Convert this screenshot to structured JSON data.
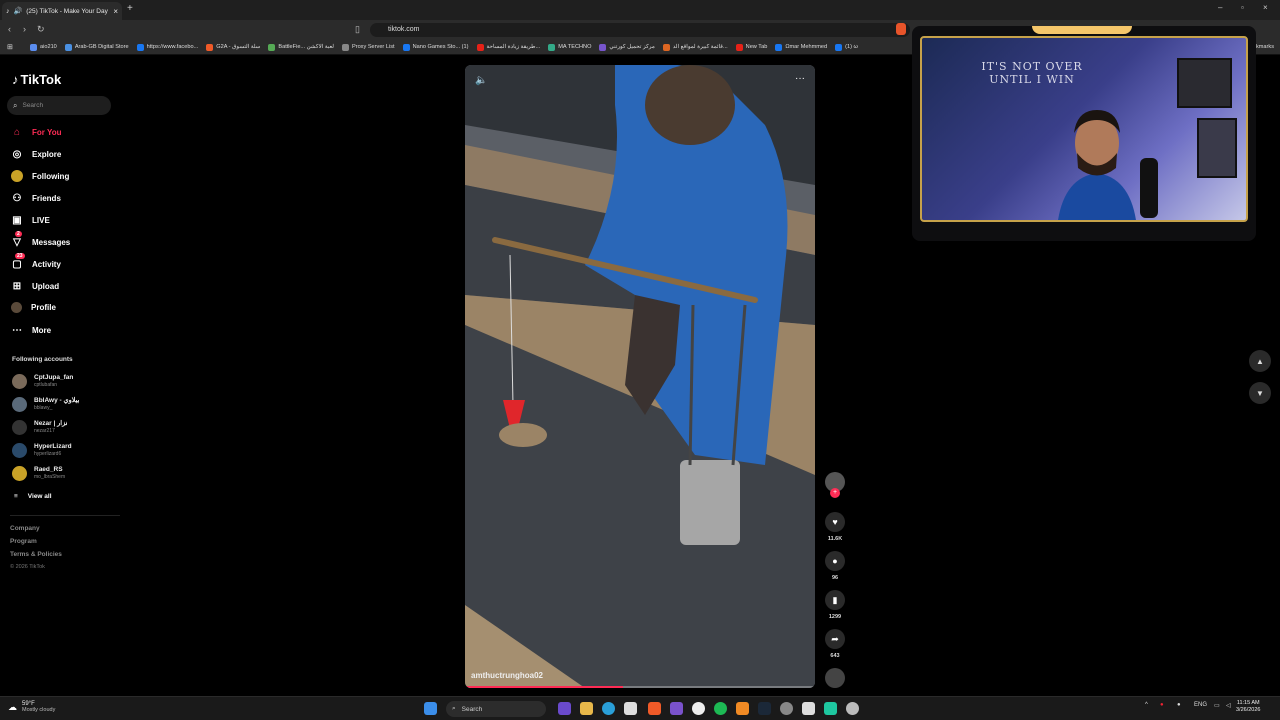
{
  "browser": {
    "tab_title": "(25) TikTok - Make Your Day",
    "url": "tiktok.com",
    "bookmarks": [
      {
        "label": "aio210",
        "color": "#5b8def"
      },
      {
        "label": "Arab-GB Digital Store",
        "color": "#4a90e2"
      },
      {
        "label": "https://www.facebo...",
        "color": "#1877f2"
      },
      {
        "label": "G2A - سلة التسوق",
        "color": "#f05a28"
      },
      {
        "label": "BattleFie... لعبة الاكشن",
        "color": "#55aa55"
      },
      {
        "label": "Proxy Server List",
        "color": "#888888"
      },
      {
        "label": "Nano Games Sto... (1)",
        "color": "#1877f2"
      },
      {
        "label": "طريقة زيادة المساحة...",
        "color": "#e62117"
      },
      {
        "label": "MA TECHNO",
        "color": "#33aa88"
      },
      {
        "label": "مركز تحميل كورتني",
        "color": "#7755cc"
      },
      {
        "label": "قائمة كبيرة لمواقع الد...",
        "color": "#dd6622"
      },
      {
        "label": "New Tab",
        "color": "#e62117"
      },
      {
        "label": "Ωmar Mehmmed",
        "color": "#1877f2"
      },
      {
        "label": "(1) ω",
        "color": "#1877f2"
      }
    ],
    "bookmarks_end": "Bookmarks"
  },
  "tiktok": {
    "logo": "TikTok",
    "search_placeholder": "Search",
    "nav": [
      {
        "label": "For You",
        "icon": "home-icon",
        "active": true
      },
      {
        "label": "Explore",
        "icon": "compass-icon"
      },
      {
        "label": "Following",
        "icon": "following-icon"
      },
      {
        "label": "Friends",
        "icon": "friends-icon"
      },
      {
        "label": "LIVE",
        "icon": "live-icon"
      },
      {
        "label": "Messages",
        "icon": "messages-icon",
        "badge": "2"
      },
      {
        "label": "Activity",
        "icon": "activity-icon",
        "badge": "23"
      },
      {
        "label": "Upload",
        "icon": "upload-icon"
      },
      {
        "label": "Profile",
        "icon": "profile-icon"
      },
      {
        "label": "More",
        "icon": "more-icon"
      }
    ],
    "following_title": "Following accounts",
    "accounts": [
      {
        "name": "CptJupa_fan",
        "user": "cptlubafan"
      },
      {
        "name": "BblAwy - بيلاوي",
        "user": "bblawy_"
      },
      {
        "name": "Nezar | نزار",
        "user": "nezar217"
      },
      {
        "name": "HyperLizard",
        "user": "hyperlizard6"
      },
      {
        "name": "Raed_RS",
        "user": "mo_lbraShem"
      }
    ],
    "view_all": "View all",
    "footer": [
      "Company",
      "Program",
      "Terms & Policies"
    ],
    "copyright": "© 2026 TikTok",
    "video": {
      "caption": "amthuctrunghoa02",
      "progress": 0.45
    },
    "actions": [
      {
        "icon": "heart-icon",
        "count": "11.6K"
      },
      {
        "icon": "comment-icon",
        "count": "96"
      },
      {
        "icon": "bookmark-icon",
        "count": "1299"
      },
      {
        "icon": "share-icon",
        "count": "643"
      }
    ]
  },
  "webcam": {
    "quote_line1": "IT'S NOT OVER",
    "quote_line2": "UNTIL I WIN"
  },
  "taskbar": {
    "temp": "59°F",
    "weather": "Mostly cloudy",
    "search": "Search",
    "lang": "ENG",
    "time": "11:15 AM",
    "date": "3/26/2026"
  }
}
